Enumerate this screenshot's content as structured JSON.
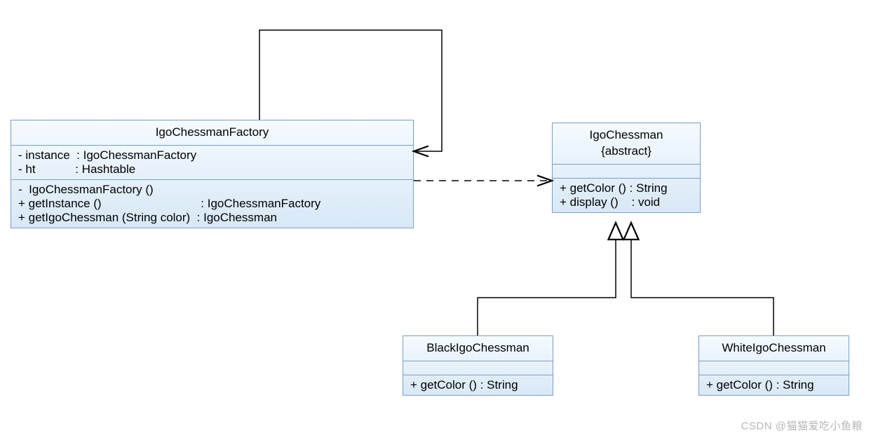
{
  "factory": {
    "name": "IgoChessmanFactory",
    "attr1": "- instance  : IgoChessmanFactory",
    "attr2": "- ht            : Hashtable",
    "op1": "-  IgoChessmanFactory ()",
    "op2": "+ getInstance ()                              : IgoChessmanFactory",
    "op3": "+ getIgoChessman (String color)  : IgoChessman"
  },
  "abstract": {
    "name": "IgoChessman",
    "stereotype": "{abstract}",
    "op1": "+ getColor () : String",
    "op2": "+ display ()    : void"
  },
  "black": {
    "name": "BlackIgoChessman",
    "op1": "+ getColor () : String"
  },
  "white": {
    "name": "WhiteIgoChessman",
    "op1": "+ getColor () : String"
  },
  "watermark": "CSDN @猫猫爱吃小鱼粮"
}
